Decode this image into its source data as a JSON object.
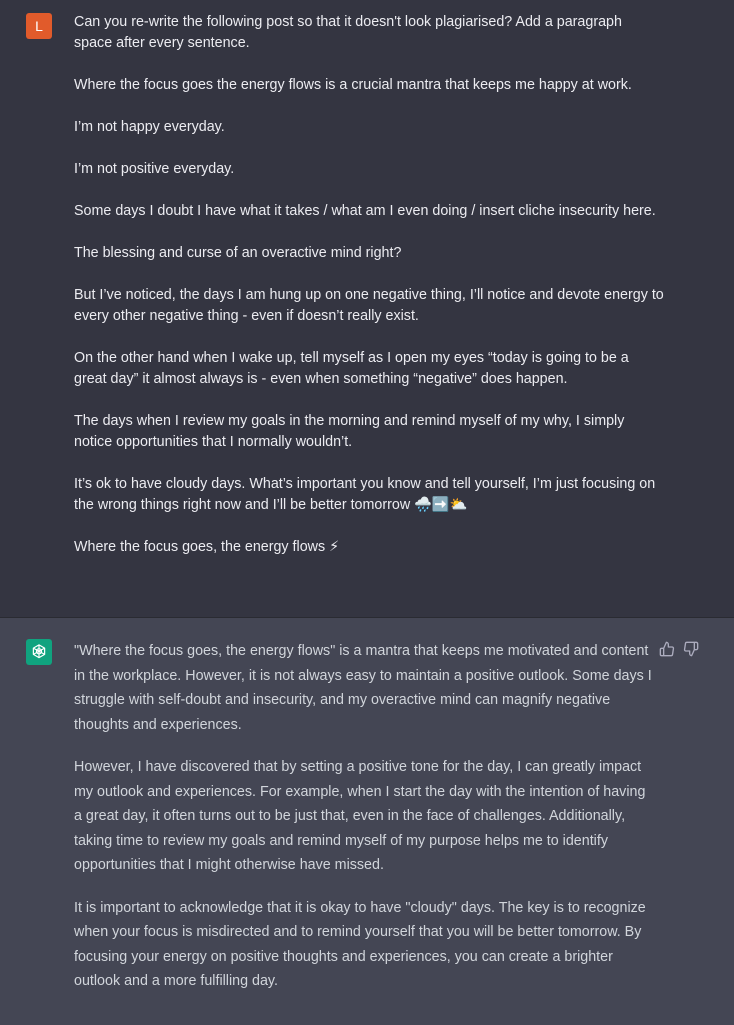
{
  "user": {
    "avatar_letter": "L",
    "paragraphs": [
      "Can you re-write the following post so that it doesn't look plagiarised? Add a paragraph space after every sentence.",
      "Where the focus goes the energy flows is a crucial mantra that keeps me happy at work.",
      "I’m not happy everyday.",
      "I’m not positive everyday.",
      "Some days I doubt I have what it takes / what am I even doing / insert cliche insecurity here.",
      "The blessing and curse of an overactive mind right?",
      "But I’ve noticed, the days I am hung up on one negative thing, I’ll notice and devote energy to every other negative thing - even if doesn’t really exist.",
      "On the other hand when I wake up, tell myself as I open my eyes “today is going to be a great day” it almost always is - even when something “negative” does happen.",
      "The days when I review my goals in the morning and remind myself of my why, I simply notice opportunities that I normally wouldn’t.",
      "It’s ok to have cloudy days. What’s important you know and tell yourself, I’m just focusing on the wrong things right now and I’ll be better tomorrow 🌧️➡️⛅",
      "Where the focus goes, the energy flows ⚡"
    ]
  },
  "assistant": {
    "paragraphs": [
      "\"Where the focus goes, the energy flows\" is a mantra that keeps me motivated and content in the workplace. However, it is not always easy to maintain a positive outlook. Some days I struggle with self-doubt and insecurity, and my overactive mind can magnify negative thoughts and experiences.",
      "However, I have discovered that by setting a positive tone for the day, I can greatly impact my outlook and experiences. For example, when I start the day with the intention of having a great day, it often turns out to be just that, even in the face of challenges. Additionally, taking time to review my goals and remind myself of my purpose helps me to identify opportunities that I might otherwise have missed.",
      "It is important to acknowledge that it is okay to have \"cloudy\" days. The key is to recognize when your focus is misdirected and to remind yourself that you will be better tomorrow. By focusing your energy on positive thoughts and experiences, you can create a brighter outlook and a more fulfilling day."
    ],
    "feedback_icons": [
      "thumbs-up-icon",
      "thumbs-down-icon"
    ]
  },
  "colors": {
    "user_bg": "#343541",
    "assistant_bg": "#444654",
    "user_avatar": "#e15b2b",
    "assistant_avatar": "#10a37f"
  }
}
